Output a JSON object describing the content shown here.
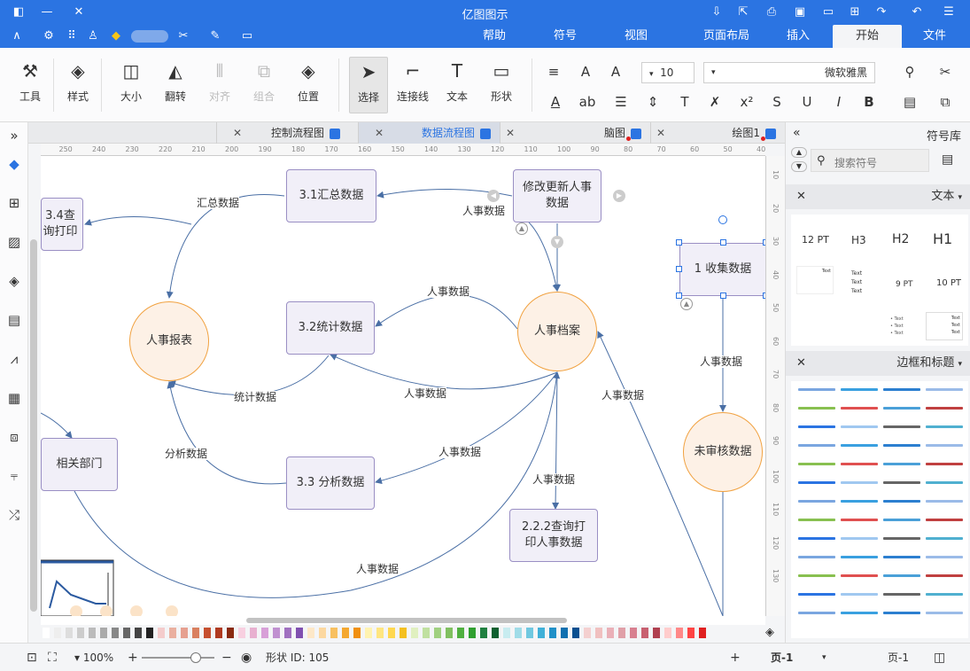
{
  "app": {
    "title": "亿图图示"
  },
  "ribbon_tabs": [
    "文件",
    "开始",
    "插入",
    "页面布局",
    "视图",
    "符号",
    "帮助"
  ],
  "ribbon_active_tab": "开始",
  "ribbon": {
    "tools_label": "工具",
    "style_label": "样式",
    "size_label": "大小",
    "flip_label": "翻转",
    "align_label": "对齐",
    "group_label": "组合",
    "position_label": "位置",
    "select_label": "选择",
    "connector_label": "连接线",
    "text_label": "文本",
    "shape_label": "形状",
    "font_size": "10",
    "font_name": "微软雅黑"
  },
  "doc_tabs": [
    {
      "label": "绘图1"
    },
    {
      "label": "脑图"
    },
    {
      "label": "数据流程图"
    },
    {
      "label": "控制流程图"
    }
  ],
  "right_panel": {
    "title": "符号库",
    "search_placeholder": "搜索符号",
    "section_text": "文本",
    "section_border": "边框和标题",
    "text_styles": {
      "h1": "H1",
      "h2": "H2",
      "h3": "H3",
      "pt12": "12 PT",
      "pt10": "10 PT",
      "pt9": "9 PT",
      "text": "Text"
    }
  },
  "diagram": {
    "nodes": {
      "n31": "3.1汇总数据",
      "n34": "3.4查询打印",
      "nupdate": "修改更新人事数据",
      "n1": "1 收集数据",
      "nreport": "人事报表",
      "n32": "3.2统计数据",
      "narchive": "人事档案",
      "nunreviewed": "未审核数据",
      "ndept": "相关部门",
      "n33": "3.3 分析数据",
      "n222": "2.2.2查询打印人事数据"
    },
    "edges": {
      "e_summary": "汇总数据",
      "e1": "人事数据",
      "e2": "人事数据",
      "e3": "人事数据",
      "e_stats": "统计数据",
      "e4": "人事数据",
      "e5": "人事数据",
      "e_analysis": "分析数据",
      "e6": "人事数据",
      "e7": "人事数据",
      "e8": "人事数据"
    }
  },
  "status": {
    "page_label": "页-1",
    "page_tab": "页-1",
    "shape_id": "形状 ID: 105",
    "zoom": "100%"
  },
  "rulers": {
    "h_ticks": [
      "40",
      "50",
      "60",
      "70",
      "80",
      "90",
      "100",
      "110",
      "120",
      "130",
      "140",
      "150",
      "160",
      "170",
      "180",
      "190",
      "200",
      "210",
      "220",
      "230",
      "240",
      "250"
    ],
    "v_ticks": [
      "10",
      "20",
      "30",
      "40",
      "50",
      "60",
      "70",
      "80",
      "90",
      "100",
      "110",
      "120",
      "130"
    ]
  },
  "colors": {
    "brand": "#2b74e2",
    "node_rect_fill": "#f1eff8",
    "node_rect_border": "#9a8fc4",
    "node_circle_fill": "#fdf1e6",
    "node_circle_border": "#f1a241",
    "edge": "#4a6fa5"
  }
}
